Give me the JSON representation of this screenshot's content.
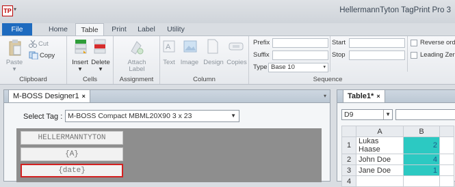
{
  "app": {
    "logo": "TP",
    "title": "HellermannTyton TagPrint Pro 3"
  },
  "ribbon_tabs": [
    "File",
    "Home",
    "Table",
    "Print",
    "Label",
    "Utility"
  ],
  "ribbon": {
    "clipboard": {
      "paste": "Paste",
      "cut": "Cut",
      "copy": "Copy",
      "group": "Clipboard"
    },
    "cells": {
      "insert": "Insert",
      "delete": "Delete",
      "group": "Cells"
    },
    "assignment": {
      "attach": "Attach",
      "label": "Label",
      "group": "Assignment"
    },
    "column": {
      "text": "Text",
      "image": "Image",
      "design": "Design",
      "copies": "Copies",
      "group": "Column"
    },
    "format": {
      "prefix": "Prefix",
      "suffix": "Suffix",
      "type": "Type",
      "type_value": "Base 10"
    },
    "sequence": {
      "start": "Start",
      "stop": "Stop",
      "reverse": "Reverse orde",
      "leading": "Leading Zero",
      "group": "Sequence"
    }
  },
  "designer": {
    "tab": "M-BOSS Designer1",
    "close": "×",
    "select_tag_label": "Select Tag :",
    "select_tag_value": "M-BOSS Compact MBML20X90 3 x 23",
    "lines": [
      "HELLERMANNTYTON",
      "{A}",
      "{date}"
    ]
  },
  "table": {
    "tab": "Table1*",
    "close": "×",
    "name_box": "D9",
    "columns": [
      "A",
      "B"
    ],
    "rows": [
      {
        "n": "1",
        "a": "Lukas Haase",
        "b": "2"
      },
      {
        "n": "2",
        "a": "John Doe",
        "b": "4"
      },
      {
        "n": "3",
        "a": "Jane Doe",
        "b": "1"
      },
      {
        "n": "4",
        "a": "",
        "b": ""
      }
    ]
  },
  "colors": {
    "file_tab": "#1e6bbf",
    "highlight_cells": "#2cc9c2",
    "selected_line_border": "#d32020"
  }
}
